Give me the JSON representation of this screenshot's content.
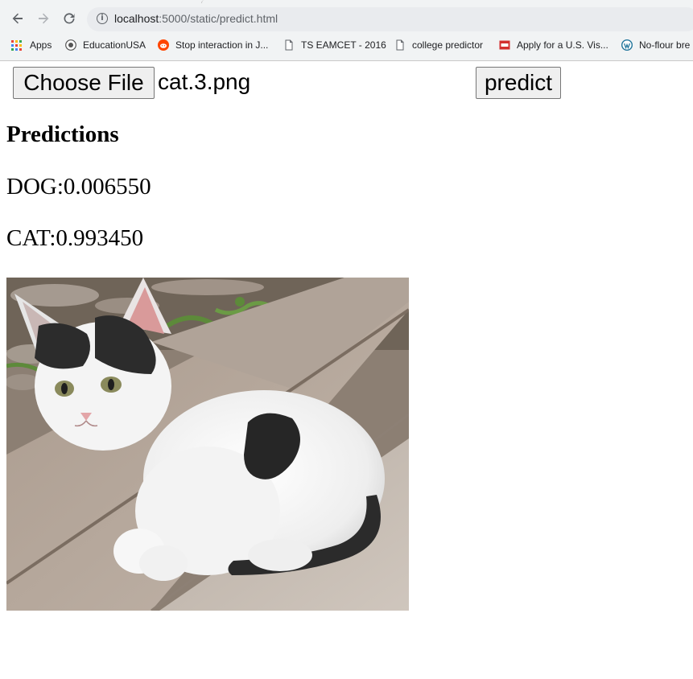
{
  "browser": {
    "url_host": "localhost",
    "url_path": ":5000/static/predict.html",
    "bookmarks": [
      {
        "label": "Apps",
        "icon": "apps-grid-icon"
      },
      {
        "label": "EducationUSA",
        "icon": "educationusa-icon"
      },
      {
        "label": "Stop interaction in J...",
        "icon": "reddit-icon"
      },
      {
        "label": "TS EAMCET - 2016",
        "icon": "page-icon"
      },
      {
        "label": "college predictor",
        "icon": "page-icon"
      },
      {
        "label": "Apply for a U.S. Vis...",
        "icon": "cgi-icon"
      },
      {
        "label": "No-flour bre",
        "icon": "wordpress-icon"
      }
    ]
  },
  "form": {
    "choose_file_label": "Choose File",
    "file_name": "cat.3.png",
    "predict_label": "predict"
  },
  "predictions": {
    "heading": "Predictions",
    "dog": "DOG:0.006550",
    "cat": "CAT:0.993450"
  },
  "colors": {
    "chrome_bg": "#f1f3f4",
    "button_bg": "#efefef",
    "button_border": "#767676"
  }
}
